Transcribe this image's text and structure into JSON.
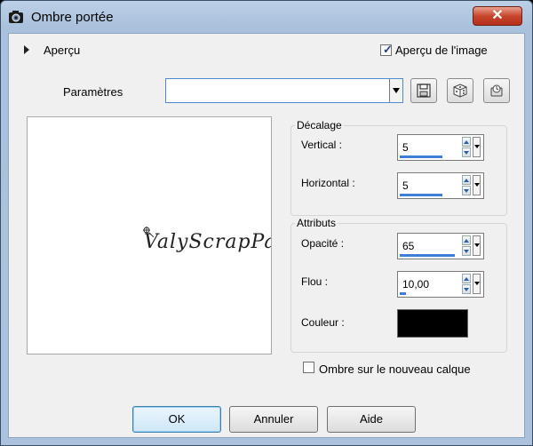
{
  "window": {
    "title": "Ombre portée",
    "close_label": "✕"
  },
  "preview_section": {
    "label": "Aperçu",
    "preview_checkbox_label": "Aperçu de l'image",
    "preview_checked": true
  },
  "presets": {
    "label": "Paramètres",
    "value": ""
  },
  "preview_pane": {
    "watermark": "ValyScrapPassion"
  },
  "offset_group": {
    "title": "Décalage",
    "vertical": {
      "label": "Vertical :",
      "value": "5"
    },
    "horizontal": {
      "label": "Horizontal :",
      "value": "5"
    }
  },
  "attributes_group": {
    "title": "Attributs",
    "opacity": {
      "label": "Opacité :",
      "value": "65"
    },
    "blur": {
      "label": "Flou :",
      "value": "10,00"
    },
    "color": {
      "label": "Couleur :",
      "value": "#000000"
    }
  },
  "new_layer": {
    "label": "Ombre sur le nouveau calque",
    "checked": false
  },
  "buttons": {
    "ok": "OK",
    "cancel": "Annuler",
    "help": "Aide"
  },
  "colors": {
    "accent": "#3d7fd6",
    "titlebar": "#aac2dd",
    "close": "#c8452d"
  }
}
